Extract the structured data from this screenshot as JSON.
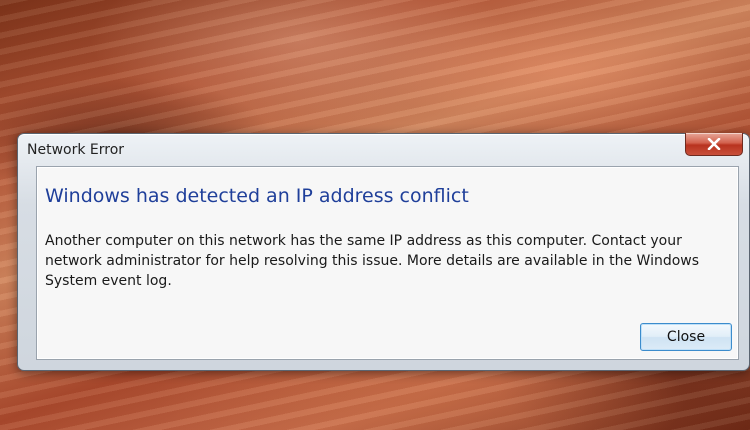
{
  "dialog": {
    "title": "Network Error",
    "close_icon": "close-x-icon",
    "main_instruction": "Windows has detected an IP address conflict",
    "body": "Another computer on this network has the same IP address as this computer. Contact your network administrator for help resolving this issue. More details are available in the Windows System event log.",
    "close_button_label": "Close",
    "main_instruction_color": "#1f3f9a",
    "close_x_color": "#c9503b"
  }
}
